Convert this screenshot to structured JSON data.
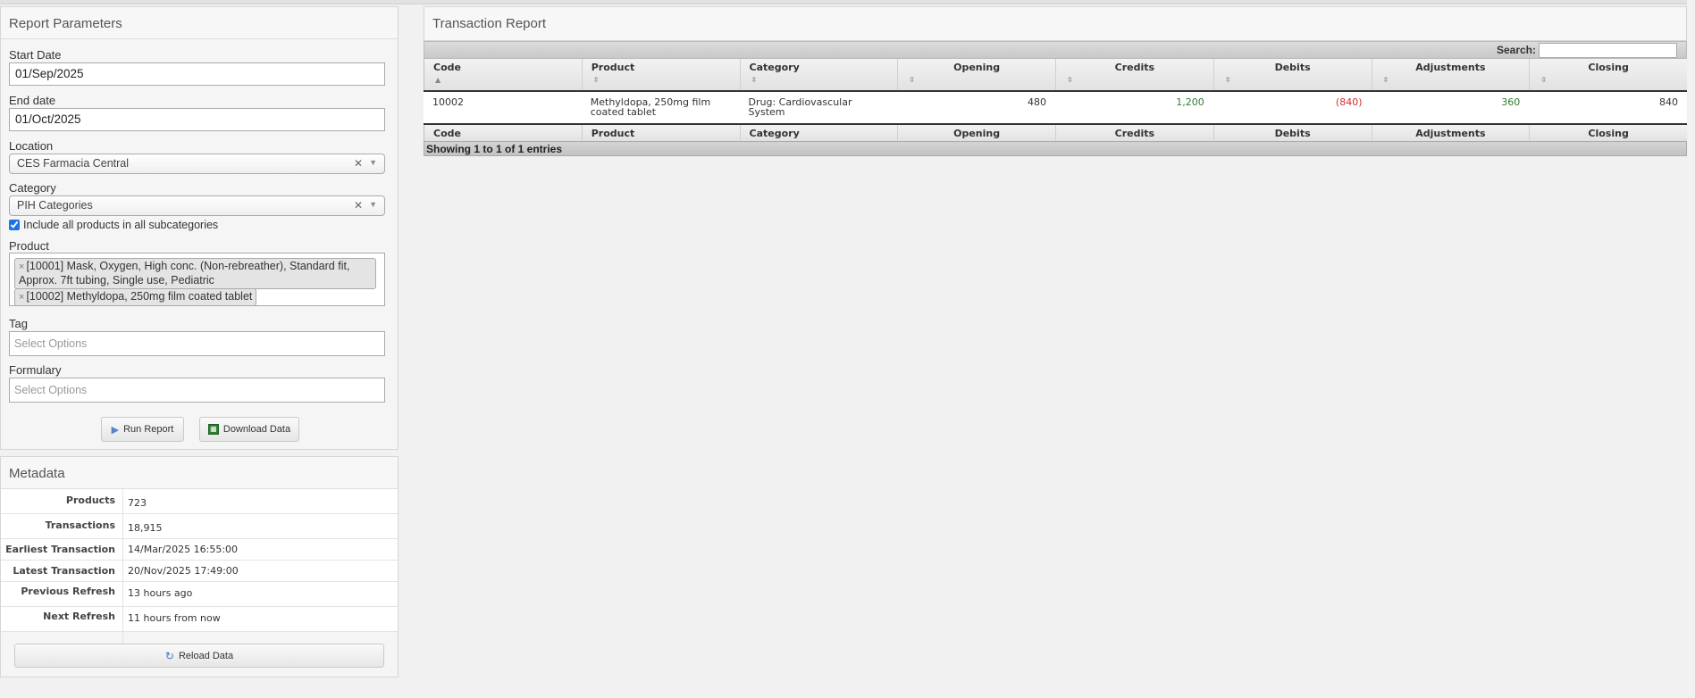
{
  "params": {
    "title": "Report Parameters",
    "start_date_label": "Start Date",
    "start_date_value": "01/Sep/2025",
    "end_date_label": "End date",
    "end_date_value": "01/Oct/2025",
    "location_label": "Location",
    "location_value": "CES Farmacia Central",
    "category_label": "Category",
    "category_value": "PIH Categories",
    "include_subcategories_label": "Include all products in all subcategories",
    "include_subcategories_checked": true,
    "product_label": "Product",
    "products": [
      "[10001] Mask, Oxygen, High conc. (Non-rebreather), Standard fit, Approx. 7ft tubing, Single use, Pediatric",
      "[10002] Methyldopa, 250mg film coated tablet"
    ],
    "tag_label": "Tag",
    "tag_placeholder": "Select Options",
    "formulary_label": "Formulary",
    "formulary_placeholder": "Select Options",
    "run_report_label": "Run Report",
    "download_data_label": "Download Data"
  },
  "metadata": {
    "title": "Metadata",
    "rows": [
      {
        "key": "Products",
        "value": "723"
      },
      {
        "key": "Transactions",
        "value": "18,915"
      },
      {
        "key": "Earliest Transaction",
        "value": "14/Mar/2025 16:55:00"
      },
      {
        "key": "Latest Transaction",
        "value": "20/Nov/2025 17:49:00"
      },
      {
        "key": "Previous Refresh",
        "value": "13 hours ago"
      },
      {
        "key": "Next Refresh",
        "value": "11 hours from now"
      }
    ],
    "reload_label": "Reload Data"
  },
  "report": {
    "title": "Transaction Report",
    "search_label": "Search:",
    "columns": [
      "Code",
      "Product",
      "Category",
      "Opening",
      "Credits",
      "Debits",
      "Adjustments",
      "Closing"
    ],
    "rows": [
      {
        "code": "10002",
        "product": "Methyldopa, 250mg film coated tablet",
        "category": "Drug: Cardiovascular System",
        "opening": "480",
        "credits": "1,200",
        "debits": "(840)",
        "adjustments": "360",
        "closing": "840"
      }
    ],
    "info": "Showing 1 to 1 of 1 entries"
  },
  "colors": {
    "positive": "#2e7d32",
    "negative": "#d32f2f"
  }
}
